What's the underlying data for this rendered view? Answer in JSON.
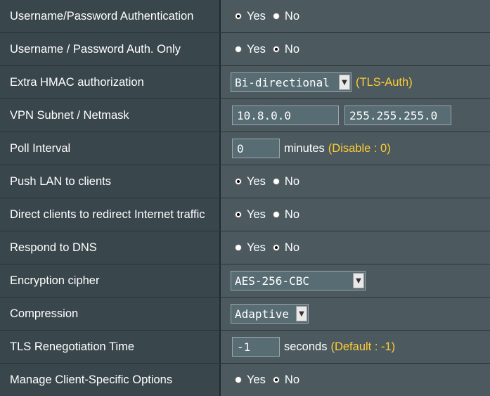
{
  "rows": [
    {
      "label": "Username/Password Authentication",
      "yes": "Yes",
      "no": "No",
      "selected": "yes"
    },
    {
      "label": "Username / Password Auth. Only",
      "yes": "Yes",
      "no": "No",
      "selected": "no"
    },
    {
      "label": "Extra HMAC authorization",
      "select_value": "Bi-directional",
      "hint": "(TLS-Auth)"
    },
    {
      "label": "VPN Subnet / Netmask",
      "subnet": "10.8.0.0",
      "netmask": "255.255.255.0"
    },
    {
      "label": "Poll Interval",
      "value": "0",
      "unit": "minutes",
      "hint": "(Disable : 0)"
    },
    {
      "label": "Push LAN to clients",
      "yes": "Yes",
      "no": "No",
      "selected": "yes"
    },
    {
      "label": "Direct clients to redirect Internet traffic",
      "yes": "Yes",
      "no": "No",
      "selected": "yes"
    },
    {
      "label": "Respond to DNS",
      "yes": "Yes",
      "no": "No",
      "selected": "no"
    },
    {
      "label": "Encryption cipher",
      "select_value": "AES-256-CBC"
    },
    {
      "label": "Compression",
      "select_value": "Adaptive"
    },
    {
      "label": "TLS Renegotiation Time",
      "value": "-1",
      "unit": "seconds",
      "hint": "(Default : -1)"
    },
    {
      "label": "Manage Client-Specific Options",
      "yes": "Yes",
      "no": "No",
      "selected": "no"
    }
  ],
  "colors": {
    "label_bg": "#39464b",
    "value_bg": "#4c5a5f",
    "hint": "#ffcc33",
    "input_bg": "#576c73"
  }
}
